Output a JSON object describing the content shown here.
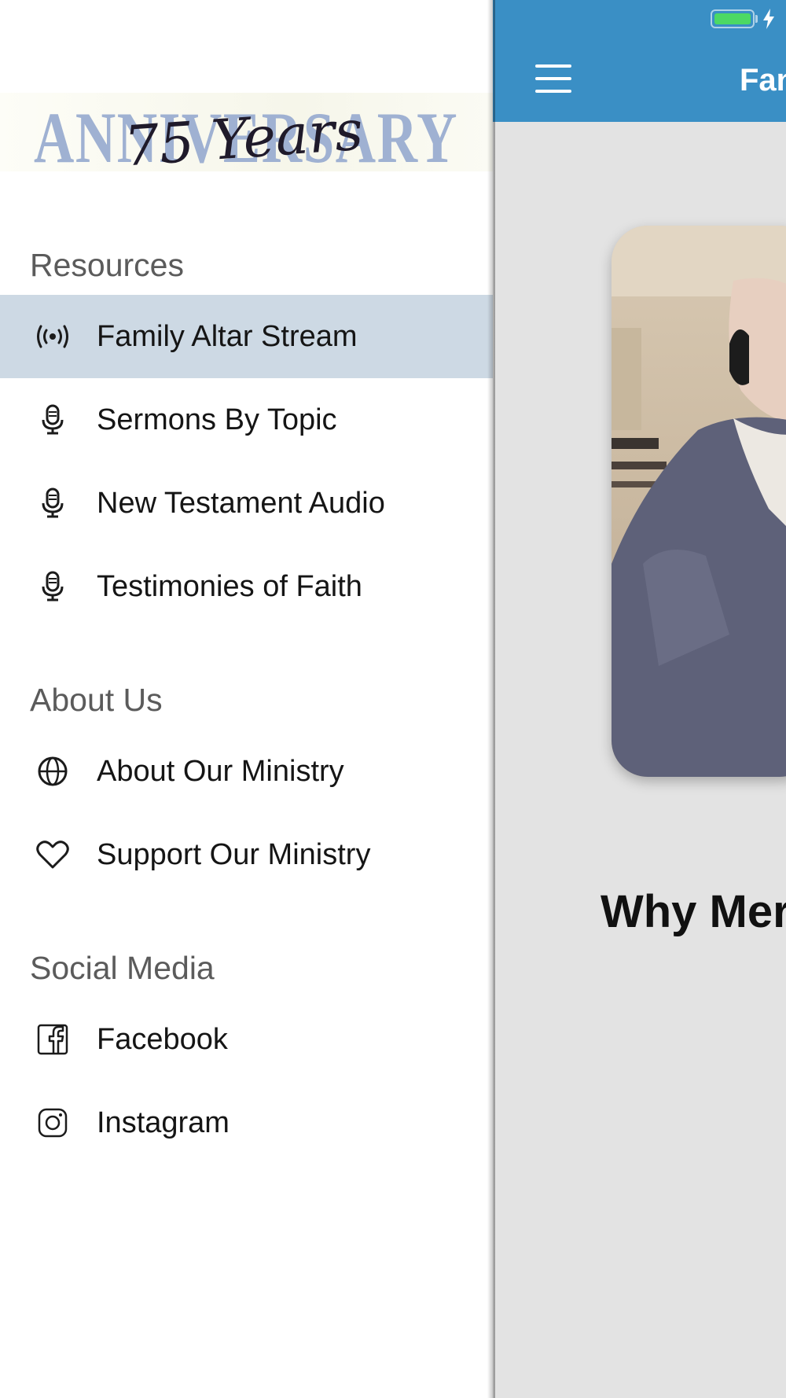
{
  "drawer": {
    "logo": {
      "word": "ANNIVERSARY",
      "script": "75 Years"
    },
    "sections": [
      {
        "header": "Resources",
        "items": [
          {
            "label": "Family Altar Stream",
            "icon": "broadcast-icon",
            "active": true
          },
          {
            "label": "Sermons By Topic",
            "icon": "microphone-icon"
          },
          {
            "label": "New Testament Audio",
            "icon": "microphone-icon"
          },
          {
            "label": "Testimonies of Faith",
            "icon": "microphone-icon"
          }
        ]
      },
      {
        "header": "About Us",
        "items": [
          {
            "label": "About Our Ministry",
            "icon": "globe-icon"
          },
          {
            "label": "Support Our Ministry",
            "icon": "heart-icon"
          }
        ]
      },
      {
        "header": "Social Media",
        "items": [
          {
            "label": "Facebook",
            "icon": "facebook-icon"
          },
          {
            "label": "Instagram",
            "icon": "instagram-icon"
          }
        ]
      }
    ]
  },
  "main": {
    "topbar": {
      "title": "Fan",
      "menu_icon": "hamburger-menu-icon"
    },
    "status": {
      "battery_charging": true
    },
    "photo": {
      "description": "photo-portrait"
    },
    "heading": "Why Mer"
  },
  "colors": {
    "topbar": "#3a8fc5",
    "active_item": "#cdd9e4",
    "main_bg": "#e3e3e3"
  }
}
